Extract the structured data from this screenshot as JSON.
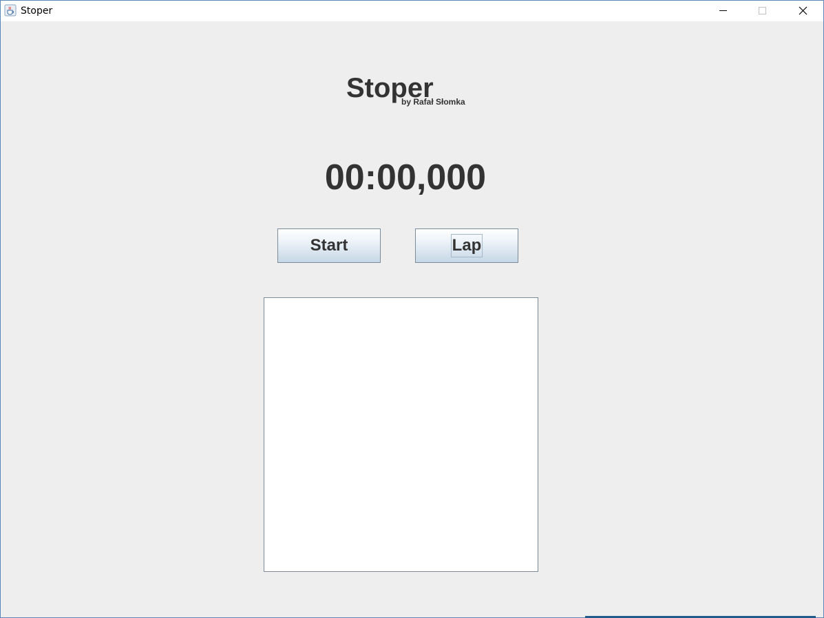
{
  "window": {
    "title": "Stoper",
    "icon": "java-coffee-cup-icon",
    "controls": {
      "minimize": "minimize-icon",
      "maximize": "maximize-icon",
      "close": "close-icon"
    }
  },
  "header": {
    "title": "Stoper",
    "author": "by Rafał Słomka"
  },
  "timer": {
    "display": "00:00,000"
  },
  "buttons": {
    "start_label": "Start",
    "lap_label": "Lap"
  },
  "laps": {
    "items": []
  },
  "colors": {
    "background": "#eeeeee",
    "text": "#333333",
    "window_border": "#5a86b8",
    "button_gradient_bottom": "#c6d7e6"
  }
}
